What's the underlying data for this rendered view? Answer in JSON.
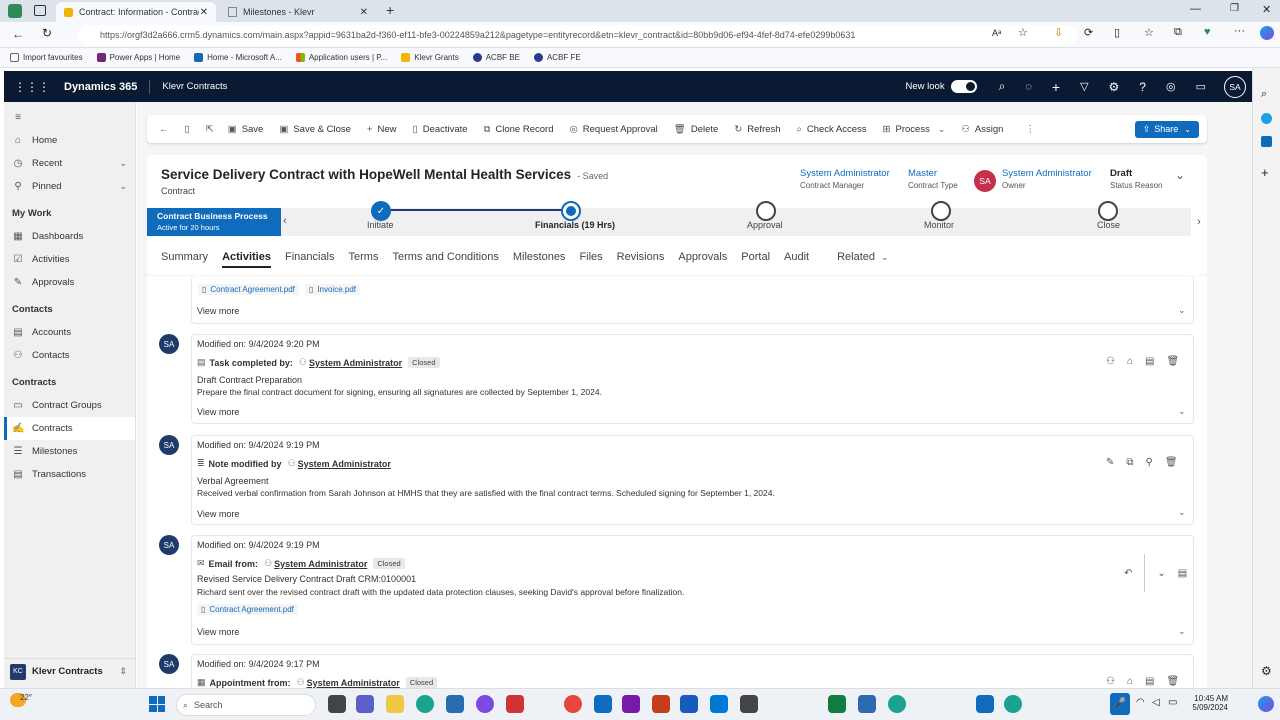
{
  "browser": {
    "tabs": [
      {
        "label": "Contract: Information - Contracts"
      },
      {
        "label": "Milestones - Klevr"
      }
    ],
    "url": "https://orgf3d2a666.crm5.dynamics.com/main.aspx?appid=9631ba2d-f360-ef11-bfe3-00224859a212&pagetype=entityrecord&etn=klevr_contract&id=80bb9d06-ef94-4fef-8d74-efe0299b0631",
    "favorites": [
      "Import favourites",
      "Power Apps | Home",
      "Home - Microsoft A...",
      "Application users | P...",
      "Klevr Grants",
      "ACBF BE",
      "ACBF FE"
    ]
  },
  "app": {
    "brand": "Dynamics 365",
    "app_name": "Klevr Contracts",
    "new_look": "New look",
    "user_initials": "SA"
  },
  "sidebar": {
    "items_top": [
      "Home",
      "Recent",
      "Pinned"
    ],
    "mywork_title": "My Work",
    "mywork": [
      "Dashboards",
      "Activities",
      "Approvals"
    ],
    "contacts_title": "Contacts",
    "contacts": [
      "Accounts",
      "Contacts"
    ],
    "contracts_title": "Contracts",
    "contracts": [
      "Contract Groups",
      "Contracts",
      "Milestones",
      "Transactions"
    ],
    "area_initials": "KC",
    "area_name": "Klevr Contracts"
  },
  "commands": [
    "Save",
    "Save & Close",
    "New",
    "Deactivate",
    "Clone Record",
    "Request Approval",
    "Delete",
    "Refresh",
    "Check Access",
    "Process",
    "Assign"
  ],
  "share_label": "Share",
  "record": {
    "title": "Service Delivery Contract with HopeWell Mental Health Services",
    "saved": "- Saved",
    "entity": "Contract",
    "fields": [
      {
        "value": "System Administrator",
        "label": "Contract Manager"
      },
      {
        "value": "Master",
        "label": "Contract Type"
      },
      {
        "value": "System Administrator",
        "label": "Owner"
      },
      {
        "value": "Draft",
        "label": "Status Reason"
      }
    ],
    "owner_initials": "SA"
  },
  "bpf": {
    "name": "Contract Business Process",
    "active": "Active for 20 hours",
    "stages": [
      "Initiate",
      "Financials  (19 Hrs)",
      "Approval",
      "Monitor",
      "Close"
    ]
  },
  "tabs": [
    "Summary",
    "Activities",
    "Financials",
    "Terms",
    "Terms and Conditions",
    "Milestones",
    "Files",
    "Revisions",
    "Approvals",
    "Portal",
    "Audit",
    "Related"
  ],
  "timeline": {
    "top_attachments": [
      "Contract Agreement.pdf",
      "Invoice.pdf"
    ],
    "view_more": "View more",
    "entries": [
      {
        "avatar": "SA",
        "modified": "Modified on: 9/4/2024 9:20 PM",
        "type": "Task completed by:",
        "user": "System Administrator",
        "badge": "Closed",
        "subject": "Draft Contract Preparation",
        "body": "Prepare the final contract document for signing, ensuring all signatures are collected by September 1, 2024."
      },
      {
        "avatar": "SA",
        "modified": "Modified on: 9/4/2024 9:19 PM",
        "type": "Note modified by",
        "user": "System Administrator",
        "subject": "Verbal Agreement",
        "body": "Received verbal confirmation from Sarah Johnson at HMHS that they are satisfied with the final contract terms. Scheduled signing for September 1, 2024."
      },
      {
        "avatar": "SA",
        "modified": "Modified on: 9/4/2024 9:19 PM",
        "type": "Email from:",
        "user": "System Administrator",
        "badge": "Closed",
        "subject": "Revised Service Delivery Contract Draft CRM:0100001",
        "body": "Richard sent over the revised contract draft with the updated data protection clauses, seeking David's approval before finalization.",
        "attachment": "Contract Agreement.pdf"
      },
      {
        "avatar": "SA",
        "modified": "Modified on: 9/4/2024 9:17 PM",
        "type": "Appointment from:",
        "user": "System Administrator",
        "badge": "Closed"
      }
    ]
  },
  "taskbar": {
    "temp": "22°",
    "search": "Search",
    "time": "10:45 AM",
    "date": "5/09/2024"
  },
  "colors": {
    "accent": "#0f6cbd",
    "nav": "#0b1a33",
    "bpf_active": "#0f6cbd"
  }
}
